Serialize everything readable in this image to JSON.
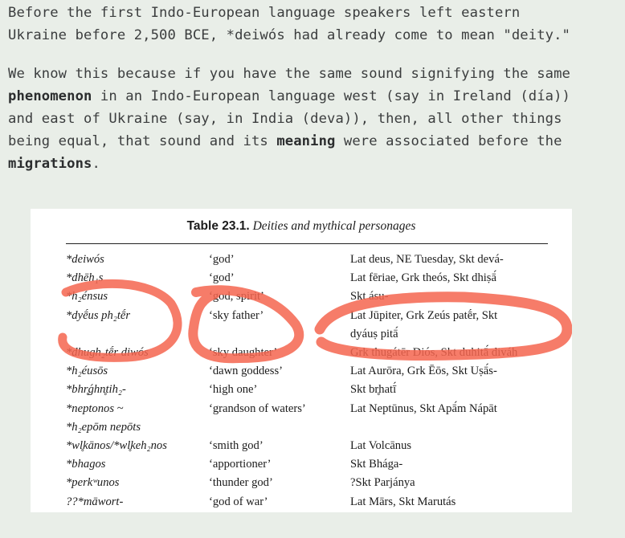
{
  "article": {
    "para1": "Before the first Indo-European language speakers left eastern\nUkraine before 2,500 BCE, *deiwós had already come to mean \"deity.\"",
    "para2": {
      "s1": "We know this because if you have the same sound signifying the same\n",
      "k1": "phenomenon",
      "s2": " in an Indo-European language west (say in Ireland (día))\nand east of Ukraine (say, in India (deva)), then, all other things\nbeing equal, that sound and its ",
      "k2": "meaning",
      "s3": " were associated before the\n",
      "k3": "migrations",
      "s4": "."
    }
  },
  "table": {
    "label": "Table 23.1.",
    "title": "Deities and mythical personages",
    "rows": [
      {
        "root": "*deiwós",
        "meaning": "‘god’",
        "reflexes": "Lat deus, NE Tuesday, Skt devá-"
      },
      {
        "root": "*dhēh₁s",
        "meaning": "‘god’",
        "reflexes": "Lat fēriae, Grk theós, Skt dhiṣā́"
      },
      {
        "root": "*h₂énsus",
        "meaning": "‘god, spirit’",
        "reflexes": "Skt ásu-"
      },
      {
        "root": "*dyḗus ph₂tḗr",
        "meaning": "‘sky father’",
        "reflexes": "Lat Jūpiter, Grk Zeús patḗr, Skt"
      },
      {
        "root": "",
        "meaning": "",
        "reflexes": "dyáuṣ pitā́"
      },
      {
        "root": "*dhugh₂tḗr diwós",
        "meaning": "‘sky daughter’",
        "reflexes": "Grk thugátēr Diós, Skt duhitā́ diváh"
      },
      {
        "root": "*h₂éusōs",
        "meaning": "‘dawn goddess’",
        "reflexes": "Lat Aurōra, Grk Ēōs, Skt Uṣā́s-"
      },
      {
        "root": "*bhr̥ǵhn̥tih₂-",
        "meaning": "‘high one’",
        "reflexes": "Skt br̥hatī́"
      },
      {
        "root": "*neptonos ~",
        "meaning": "‘grandson of waters’",
        "reflexes": "Lat Neptūnus, Skt Apā́m Nápāt"
      },
      {
        "root": "*h₂epōm nepōts",
        "meaning": "",
        "reflexes": ""
      },
      {
        "root": "*wl̥kānos/*wl̥keh₂nos",
        "meaning": "‘smith god’",
        "reflexes": "Lat Volcānus"
      },
      {
        "root": "*bhagos",
        "meaning": "‘apportioner’",
        "reflexes": "Skt Bhága-"
      },
      {
        "root": "*perkʷunos",
        "meaning": "‘thunder god’",
        "reflexes": "?Skt Parjánya"
      },
      {
        "root": "??*māwort-",
        "meaning": "‘god of war’",
        "reflexes": "Lat Mārs, Skt Marutás"
      }
    ]
  },
  "colors": {
    "background": "#e9eee8",
    "text": "#3b3d3e",
    "highlight": "#f5654f"
  }
}
